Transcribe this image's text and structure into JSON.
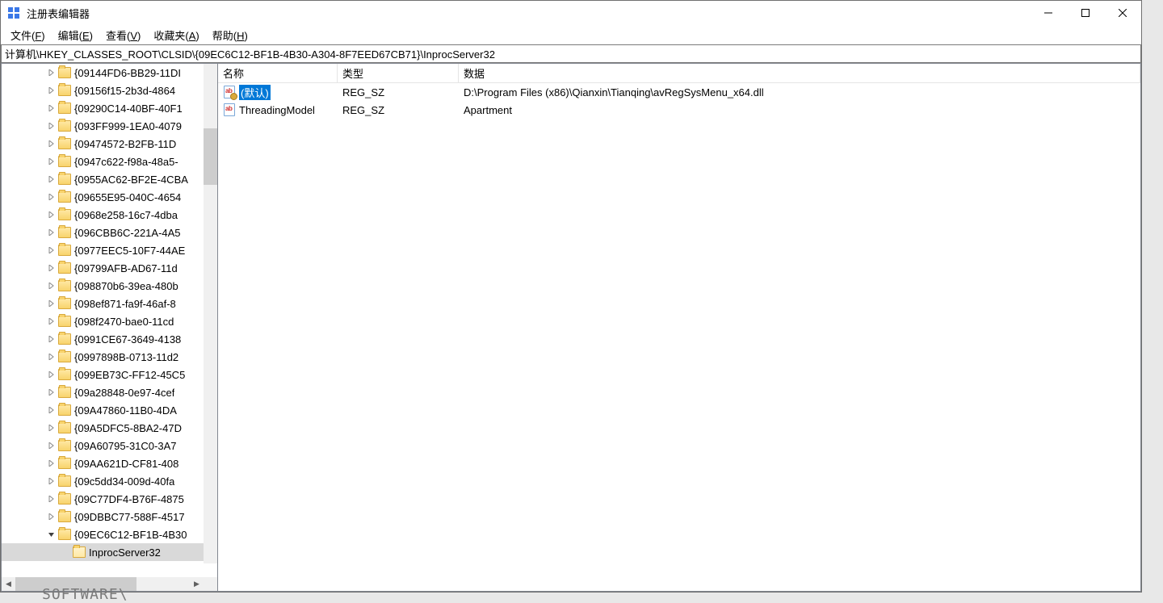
{
  "title": "注册表编辑器",
  "menu": {
    "file": "文件(",
    "file_key": "F",
    "edit": "编辑(",
    "edit_key": "E",
    "view": "查看(",
    "view_key": "V",
    "favorites": "收藏夹(",
    "favorites_key": "A",
    "help": "帮助(",
    "help_key": "H",
    "close_paren": ")"
  },
  "address": "计算机\\HKEY_CLASSES_ROOT\\CLSID\\{09EC6C12-BF1B-4B30-A304-8F7EED67CB71}\\InprocServer32",
  "tree": [
    {
      "label": "{09144FD6-BB29-11DI",
      "expand": "closed",
      "depth": 3
    },
    {
      "label": "{09156f15-2b3d-4864",
      "expand": "closed",
      "depth": 3
    },
    {
      "label": "{09290C14-40BF-40F1",
      "expand": "closed",
      "depth": 3
    },
    {
      "label": "{093FF999-1EA0-4079",
      "expand": "closed",
      "depth": 3
    },
    {
      "label": "{09474572-B2FB-11D",
      "expand": "closed",
      "depth": 3
    },
    {
      "label": "{0947c622-f98a-48a5-",
      "expand": "closed",
      "depth": 3
    },
    {
      "label": "{0955AC62-BF2E-4CBA",
      "expand": "closed",
      "depth": 3
    },
    {
      "label": "{09655E95-040C-4654",
      "expand": "closed",
      "depth": 3
    },
    {
      "label": "{0968e258-16c7-4dba",
      "expand": "closed",
      "depth": 3
    },
    {
      "label": "{096CBB6C-221A-4A5",
      "expand": "closed",
      "depth": 3
    },
    {
      "label": "{0977EEC5-10F7-44AE",
      "expand": "closed",
      "depth": 3
    },
    {
      "label": "{09799AFB-AD67-11d",
      "expand": "closed",
      "depth": 3
    },
    {
      "label": "{098870b6-39ea-480b",
      "expand": "closed",
      "depth": 3
    },
    {
      "label": "{098ef871-fa9f-46af-8",
      "expand": "closed",
      "depth": 3
    },
    {
      "label": "{098f2470-bae0-11cd",
      "expand": "closed",
      "depth": 3
    },
    {
      "label": "{0991CE67-3649-4138",
      "expand": "closed",
      "depth": 3
    },
    {
      "label": "{0997898B-0713-11d2",
      "expand": "closed",
      "depth": 3
    },
    {
      "label": "{099EB73C-FF12-45C5",
      "expand": "closed",
      "depth": 3
    },
    {
      "label": "{09a28848-0e97-4cef",
      "expand": "closed",
      "depth": 3
    },
    {
      "label": "{09A47860-11B0-4DA",
      "expand": "closed",
      "depth": 3
    },
    {
      "label": "{09A5DFC5-8BA2-47D",
      "expand": "closed",
      "depth": 3
    },
    {
      "label": "{09A60795-31C0-3A7",
      "expand": "closed",
      "depth": 3
    },
    {
      "label": "{09AA621D-CF81-408",
      "expand": "closed",
      "depth": 3
    },
    {
      "label": "{09c5dd34-009d-40fa",
      "expand": "closed",
      "depth": 3
    },
    {
      "label": "{09C77DF4-B76F-4875",
      "expand": "closed",
      "depth": 3
    },
    {
      "label": "{09DBBC77-588F-4517",
      "expand": "closed",
      "depth": 3
    },
    {
      "label": "{09EC6C12-BF1B-4B30",
      "expand": "open",
      "depth": 3
    },
    {
      "label": "InprocServer32",
      "expand": "none",
      "depth": 4,
      "selected": true
    }
  ],
  "columns": {
    "name": "名称",
    "type": "类型",
    "data": "数据"
  },
  "values": [
    {
      "name": "(默认)",
      "type": "REG_SZ",
      "data": "D:\\Program Files (x86)\\Qianxin\\Tianqing\\avRegSysMenu_x64.dll",
      "selected": true,
      "def": true
    },
    {
      "name": "ThreadingModel",
      "type": "REG_SZ",
      "data": "Apartment",
      "selected": false,
      "def": false
    }
  ],
  "below": "SOFTWARE\\"
}
